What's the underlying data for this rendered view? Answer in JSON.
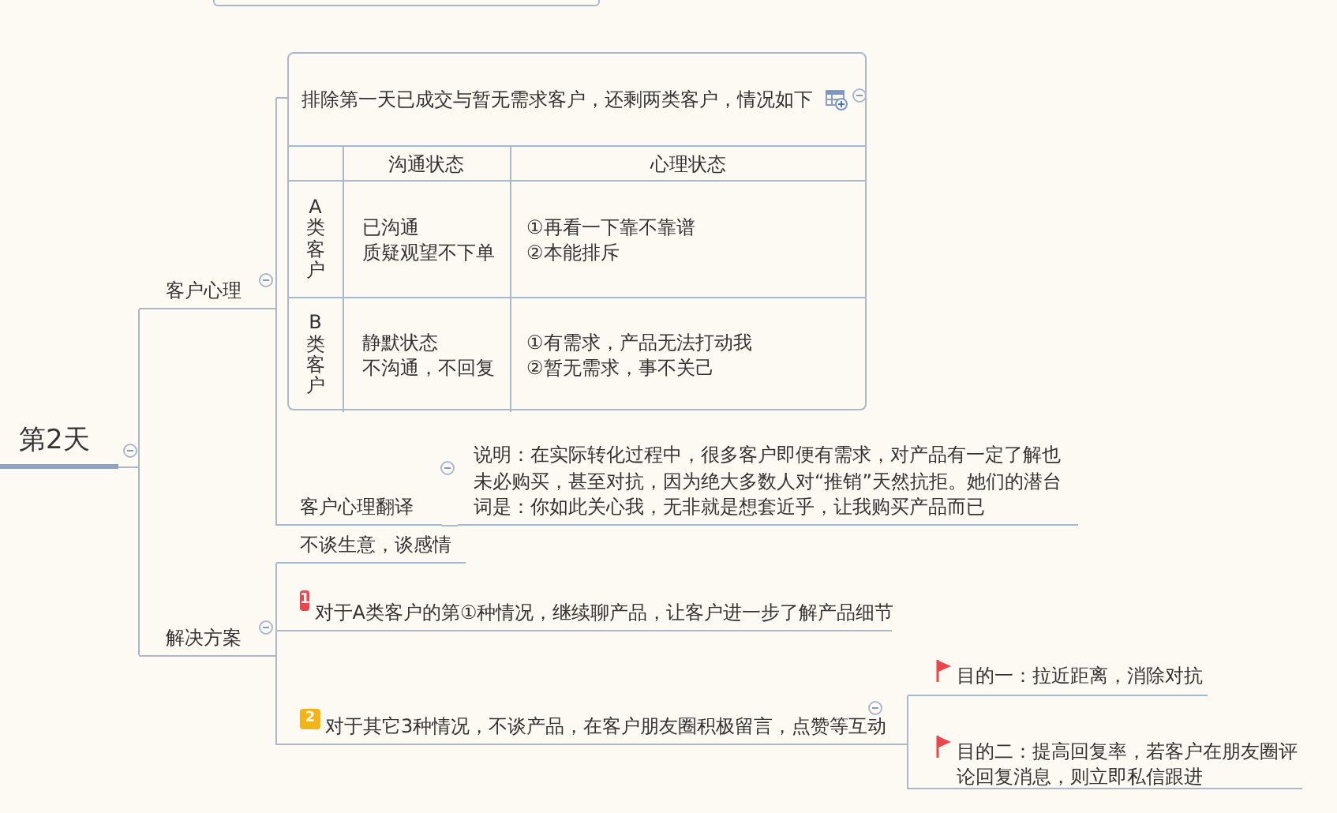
{
  "root": {
    "label": "第2天",
    "expanded": true
  },
  "branches": [
    {
      "label": "客户心理",
      "expanded": true,
      "children": [
        {
          "kind": "table",
          "title": "排除第一天已成交与暂无需求客户，还剩两类客户，情况如下",
          "expanded": true,
          "columns": [
            "沟通状态",
            "心理状态"
          ],
          "rows": [
            {
              "header": "A类客户",
              "cells": [
                [
                  "已沟通",
                  "质疑观望不下单"
                ],
                [
                  "①再看一下靠不靠谱",
                  "②本能排斥"
                ]
              ]
            },
            {
              "header": "B类客户",
              "cells": [
                [
                  "静默状态",
                  "不沟通，不回复"
                ],
                [
                  "①有需求，产品无法打动我",
                  "②暂无需求，事不关己"
                ]
              ]
            }
          ]
        },
        {
          "kind": "topic",
          "label": "客户心理翻译",
          "expanded": true,
          "children": [
            {
              "label": "说明：在实际转化过程中，很多客户即便有需求，对产品有一定了解也未必购买，甚至对抗，因为绝大多数人对“推销”天然抗拒。她们的潜台词是：你如此关心我，无非就是想套近乎，让我购买产品而已"
            }
          ]
        }
      ]
    },
    {
      "label": "解决方案",
      "expanded": true,
      "children": [
        {
          "label": "不谈生意，谈感情"
        },
        {
          "label": "对于A类客户的第①种情况，继续聊产品，让客户进一步了解产品细节",
          "priority": "1",
          "color": "#e8474b"
        },
        {
          "label": "对于其它3种情况，不谈产品，在客户朋友圈积极留言，点赞等互动",
          "priority": "2",
          "color": "#f5b31b",
          "expanded": true,
          "children": [
            {
              "label": "目的一：拉近距离，消除对抗",
              "flagged": true
            },
            {
              "label": "目的二：提高回复率，若客户在朋友圈评论回复消息，则立即私信跟进",
              "flagged": true
            }
          ]
        }
      ]
    }
  ]
}
